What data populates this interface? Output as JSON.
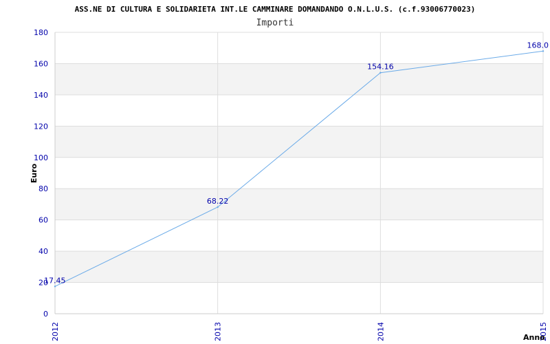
{
  "chart_data": {
    "type": "line",
    "title": "ASS.NE DI CULTURA E SOLIDARIETA INT.LE CAMMINARE DOMANDANDO O.N.L.U.S. (c.f.93006770023)",
    "subtitle": "Importi",
    "xlabel": "Anno",
    "ylabel": "Euro",
    "categories": [
      "2012",
      "2013",
      "2014",
      "2015"
    ],
    "series": [
      {
        "values": [
          17.45,
          68.22,
          154.16,
          168.0
        ],
        "labels": [
          "17.45",
          "68.22",
          "154.16",
          "168.0"
        ]
      }
    ],
    "ylim": [
      0,
      180
    ],
    "yticks": [
      "0",
      "20",
      "40",
      "60",
      "80",
      "100",
      "120",
      "140",
      "160",
      "180"
    ],
    "grid": true,
    "colors": {
      "line": "#6aaae8",
      "band": "#f3f3f3",
      "tick_text": "#0000aa"
    }
  }
}
